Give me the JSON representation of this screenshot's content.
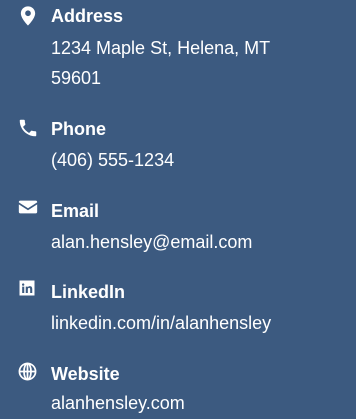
{
  "contact": {
    "address": {
      "label": "Address",
      "line1": "1234 Maple St, Helena, MT",
      "line2": "59601",
      "icon": "map-marker-icon"
    },
    "phone": {
      "label": "Phone",
      "value": "(406) 555-1234",
      "icon": "phone-icon"
    },
    "email": {
      "label": "Email",
      "value": "alan.hensley@email.com",
      "icon": "envelope-icon"
    },
    "linkedin": {
      "label": "LinkedIn",
      "value": "linkedin.com/in/alanhensley",
      "icon": "linkedin-icon"
    },
    "website": {
      "label": "Website",
      "value": "alanhensley.com",
      "icon": "globe-icon"
    }
  },
  "colors": {
    "background": "#3c5a80",
    "text": "#ffffff"
  }
}
